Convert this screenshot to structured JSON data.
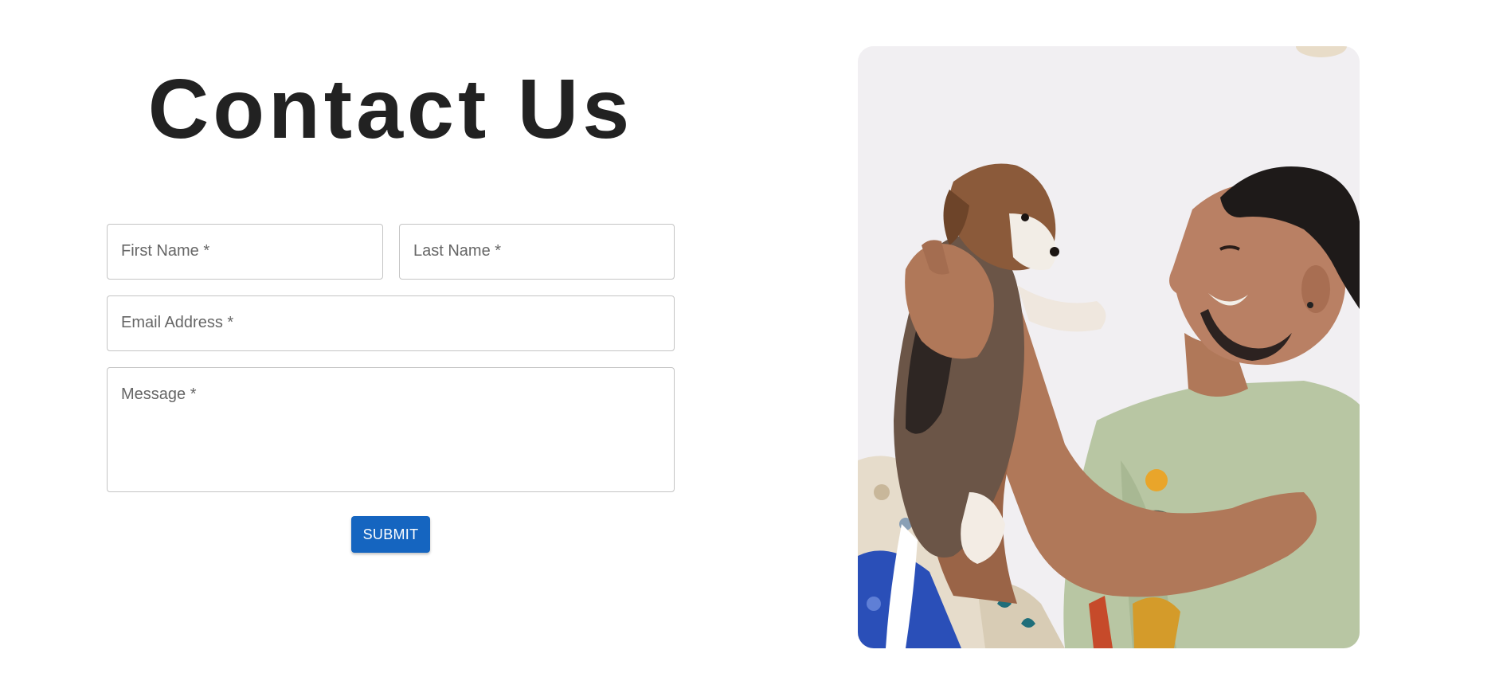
{
  "contact": {
    "title": "Contact Us",
    "fields": {
      "first_name": "First Name *",
      "last_name": "Last Name *",
      "email": "Email Address *",
      "message": "Message *"
    },
    "submit_label": "SUBMIT"
  },
  "colors": {
    "accent": "#1565c0",
    "title": "#222222",
    "field_border": "#c4c4c4",
    "placeholder": "#666666"
  },
  "photo": {
    "subject": "man-holding-puppy-photo"
  }
}
